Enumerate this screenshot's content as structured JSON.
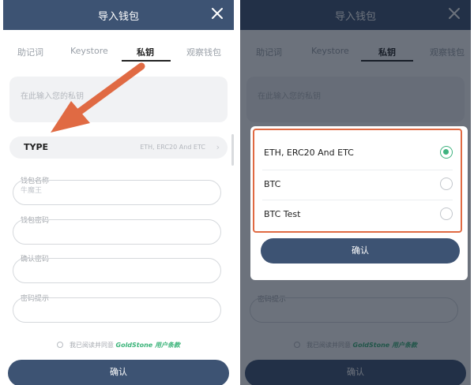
{
  "header": {
    "title": "导入钱包"
  },
  "tabs": [
    {
      "label": "助记词"
    },
    {
      "label": "Keystore"
    },
    {
      "label": "私钥"
    },
    {
      "label": "观察钱包"
    }
  ],
  "private_key": {
    "placeholder": "在此输入您的私钥"
  },
  "type_selector": {
    "label": "TYPE",
    "value": "ETH, ERC20 And ETC",
    "chevron": "›"
  },
  "fields": [
    {
      "label": "钱包名称",
      "sub": "牛魔王"
    },
    {
      "label": "钱包密码"
    },
    {
      "label": "确认密码"
    },
    {
      "label": "密码提示"
    }
  ],
  "agreement": {
    "text": "我已阅读并同意",
    "link": "GoldStone 用户条款"
  },
  "confirm_label": "确认",
  "type_popup": {
    "options": [
      {
        "label": "ETH, ERC20 And ETC",
        "selected": true
      },
      {
        "label": "BTC",
        "selected": false
      },
      {
        "label": "BTC Test",
        "selected": false
      }
    ],
    "confirm_label": "确认"
  },
  "colors": {
    "header": "#3d5373",
    "arrow": "#e06a43",
    "highlight_border": "#e06a43",
    "selected": "#3fb37f",
    "link": "#3cb47a"
  },
  "icons": {
    "close": "close-icon",
    "pointer": "red-arrow-annotation"
  }
}
